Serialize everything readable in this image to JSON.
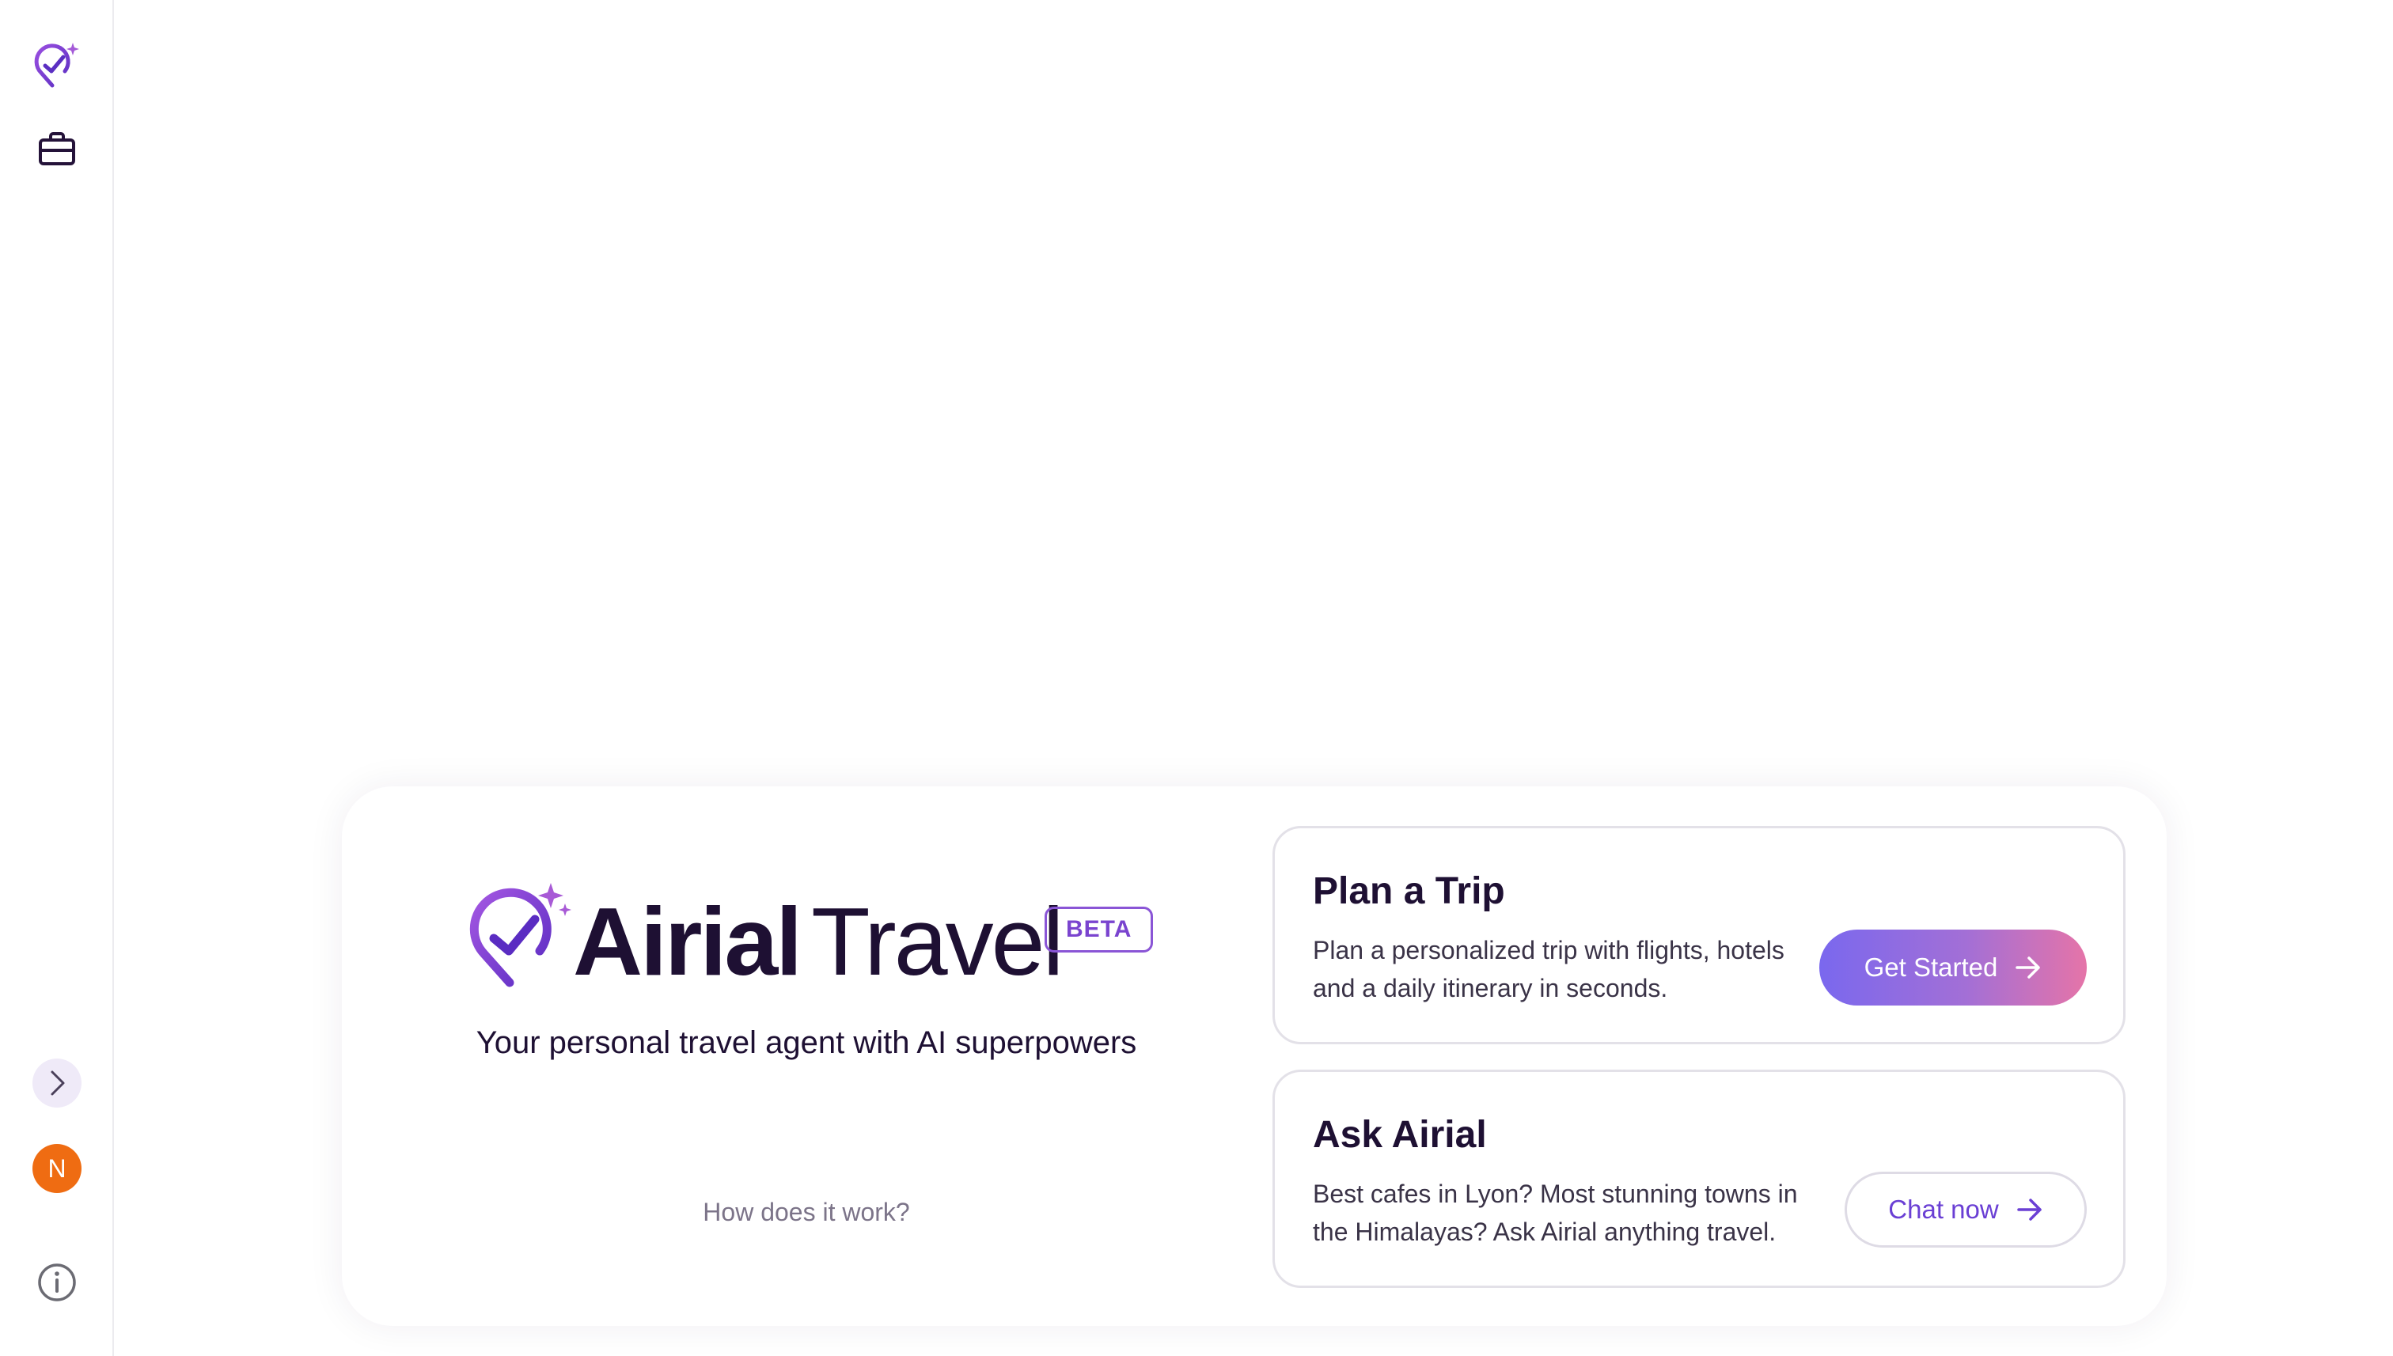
{
  "sidebar": {
    "avatar_initial": "N"
  },
  "brand": {
    "name_bold": "Airial",
    "name_light": "Travel",
    "badge": "BETA",
    "tagline": "Your personal travel agent with AI superpowers",
    "how_link": "How does it work?"
  },
  "options": {
    "plan": {
      "title": "Plan a Trip",
      "description": "Plan a personalized trip with flights, hotels and a daily itinerary in seconds.",
      "button_label": "Get Started"
    },
    "ask": {
      "title": "Ask Airial",
      "description": "Best cafes in Lyon? Most stunning towns in the Himalayas? Ask Airial anything travel.",
      "button_label": "Chat now"
    }
  },
  "colors": {
    "brand_purple": "#7a44cf",
    "avatar_orange": "#ef6c12",
    "text_dark": "#1e1033",
    "gradient_start": "#7a68ee",
    "gradient_end": "#e574a8"
  },
  "icons": {
    "sidebar_logo": "airial-logo-icon",
    "trips": "briefcase-icon",
    "expand": "chevron-right-icon",
    "info": "info-icon",
    "arrow": "arrow-right-icon"
  }
}
